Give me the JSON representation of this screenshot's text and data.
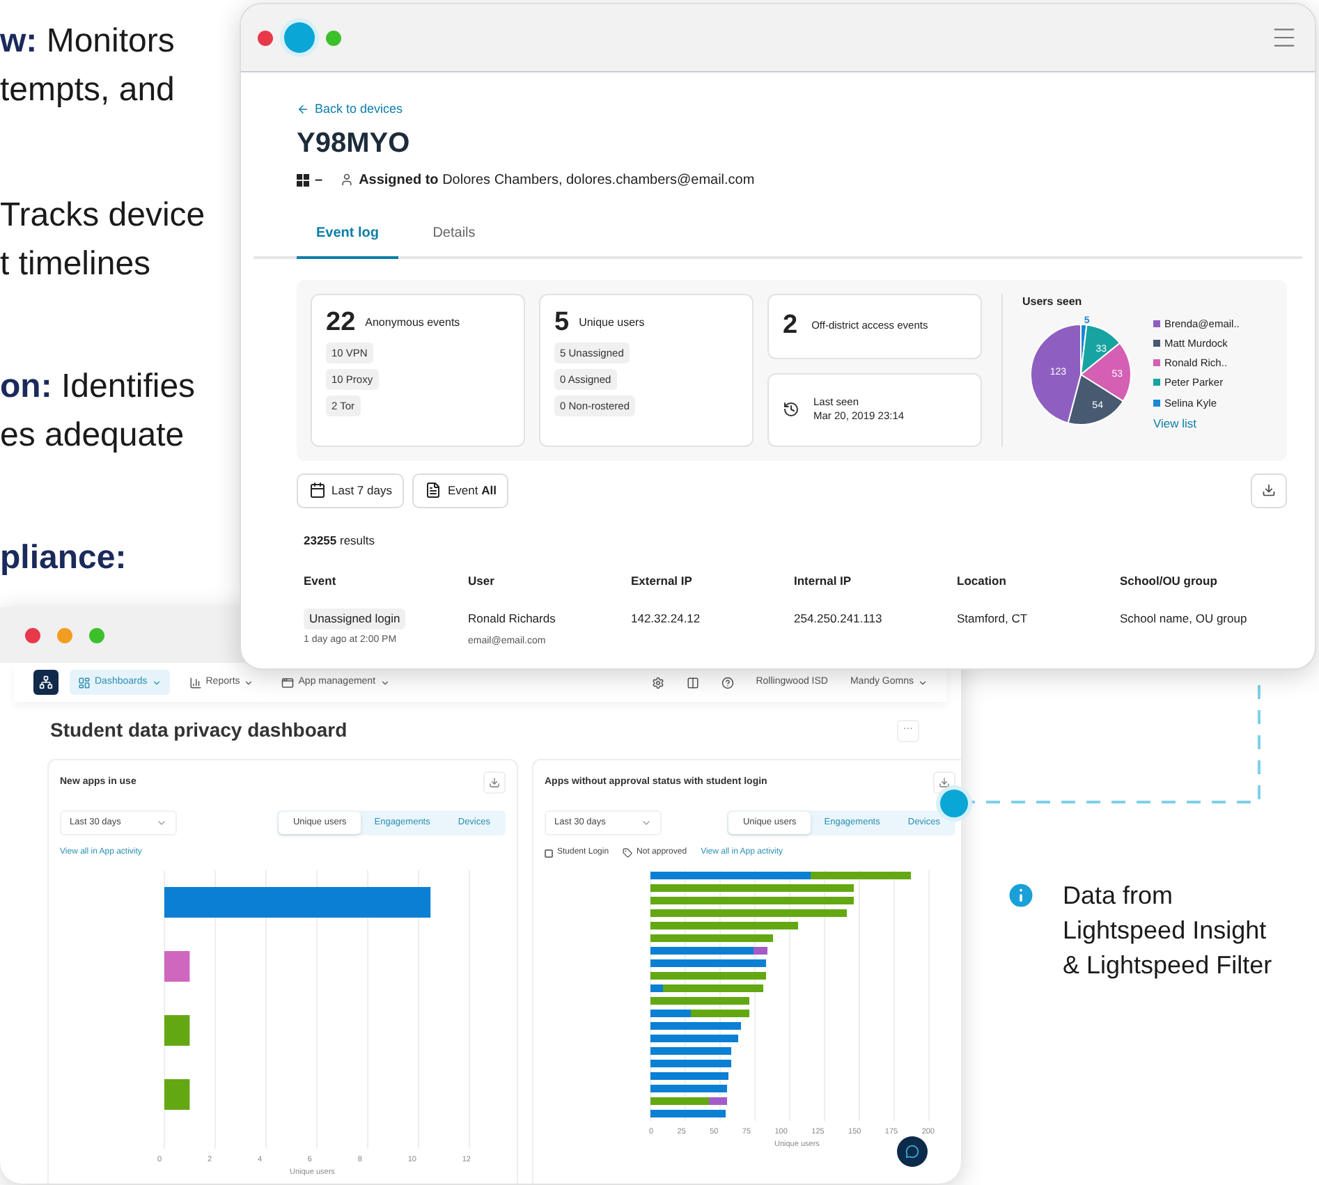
{
  "side_text": [
    {
      "lines": [
        "**w:** Monitors",
        "tempts, and"
      ]
    },
    {
      "lines": [
        "Tracks device",
        "t timelines"
      ]
    },
    {
      "lines": [
        "**on:** Identifies",
        "es adequate"
      ]
    },
    {
      "lines": [
        "**pliance:**"
      ]
    }
  ],
  "device_window": {
    "back_link": "Back to devices",
    "title": "Y98MYO",
    "os_value": "–",
    "assigned_label": "Assigned to",
    "assigned_value": "Dolores Chambers, dolores.chambers@email.com",
    "tabs": [
      {
        "label": "Event log",
        "selected": true
      },
      {
        "label": "Details",
        "selected": false
      }
    ],
    "stats": [
      {
        "number": "22",
        "label": "Anonymous events",
        "tags": [
          "10 VPN",
          "10 Proxy",
          "2 Tor"
        ]
      },
      {
        "number": "5",
        "label": "Unique users",
        "tags": [
          "5 Unassigned",
          "0 Assigned",
          "0 Non-rostered"
        ]
      }
    ],
    "off_district": {
      "number": "2",
      "label": "Off-district access events"
    },
    "last_seen": {
      "label": "Last seen",
      "value": "Mar 20, 2019 23:14"
    },
    "users_seen": {
      "title": "Users seen",
      "view_list": "View list",
      "chart_data": {
        "type": "pie",
        "categories": [
          "Brenda@email..",
          "Matt Murdock",
          "Ronald Rich..",
          "Peter Parker",
          "Selina Kyle"
        ],
        "values": [
          123,
          54,
          53,
          33,
          5
        ],
        "colors": [
          "#8e5fc0",
          "#475a72",
          "#d45fb3",
          "#17a3a0",
          "#1a86d4"
        ],
        "data_labels": true
      }
    },
    "filters": [
      {
        "kind": "date",
        "label": "Last 7 days"
      },
      {
        "kind": "event",
        "label": "Event **All**"
      }
    ],
    "results": "**23255** results",
    "table": {
      "columns": [
        "Event",
        "User",
        "External IP",
        "Internal IP",
        "Location",
        "School/OU group"
      ],
      "rows": [
        {
          "event": "Unassigned login",
          "time": "1 day ago at 2:00 PM",
          "user": "Ronald Richards",
          "email": "email@email.com",
          "external_ip": "142.32.24.12",
          "internal_ip": "254.250.241.113",
          "location": "Stamford, CT",
          "group": "School name, OU group"
        }
      ]
    }
  },
  "dashboard_window": {
    "nav": [
      {
        "label": "Dashboards",
        "selected": true
      },
      {
        "label": "Reports",
        "selected": false
      },
      {
        "label": "App management",
        "selected": false
      }
    ],
    "district": "Rollingwood ISD",
    "user": "Mandy Gomns",
    "title": "Student data privacy dashboard",
    "more": "···",
    "panels": [
      {
        "title": "New apps in use",
        "range": "Last 30 days",
        "segments": [
          {
            "label": "Unique users",
            "selected": true
          },
          {
            "label": "Engagements",
            "selected": false
          },
          {
            "label": "Devices",
            "selected": false
          }
        ],
        "link": "View all in App activity",
        "xticks": [
          "0",
          "2",
          "4",
          "6",
          "8",
          "10",
          "12"
        ],
        "xlabel": "Unique users",
        "kind": "simple"
      },
      {
        "title": "Apps without approval status with student login",
        "range": "Last 30 days",
        "segments": [
          {
            "label": "Unique users",
            "selected": true
          },
          {
            "label": "Engagements",
            "selected": false
          },
          {
            "label": "Devices",
            "selected": false
          }
        ],
        "filters": [
          {
            "kind": "checkbox",
            "label": "Student Login",
            "checked": false
          },
          {
            "kind": "tag",
            "label": "Not approved"
          }
        ],
        "link": "View all in App activity",
        "xticks": [
          "0",
          "25",
          "50",
          "75",
          "100",
          "125",
          "150",
          "175",
          "200"
        ],
        "xlabel": "Unique users",
        "kind": "stacked"
      }
    ]
  },
  "note": "Data from\nLightspeed Insight\n& Lightspeed Filter"
}
